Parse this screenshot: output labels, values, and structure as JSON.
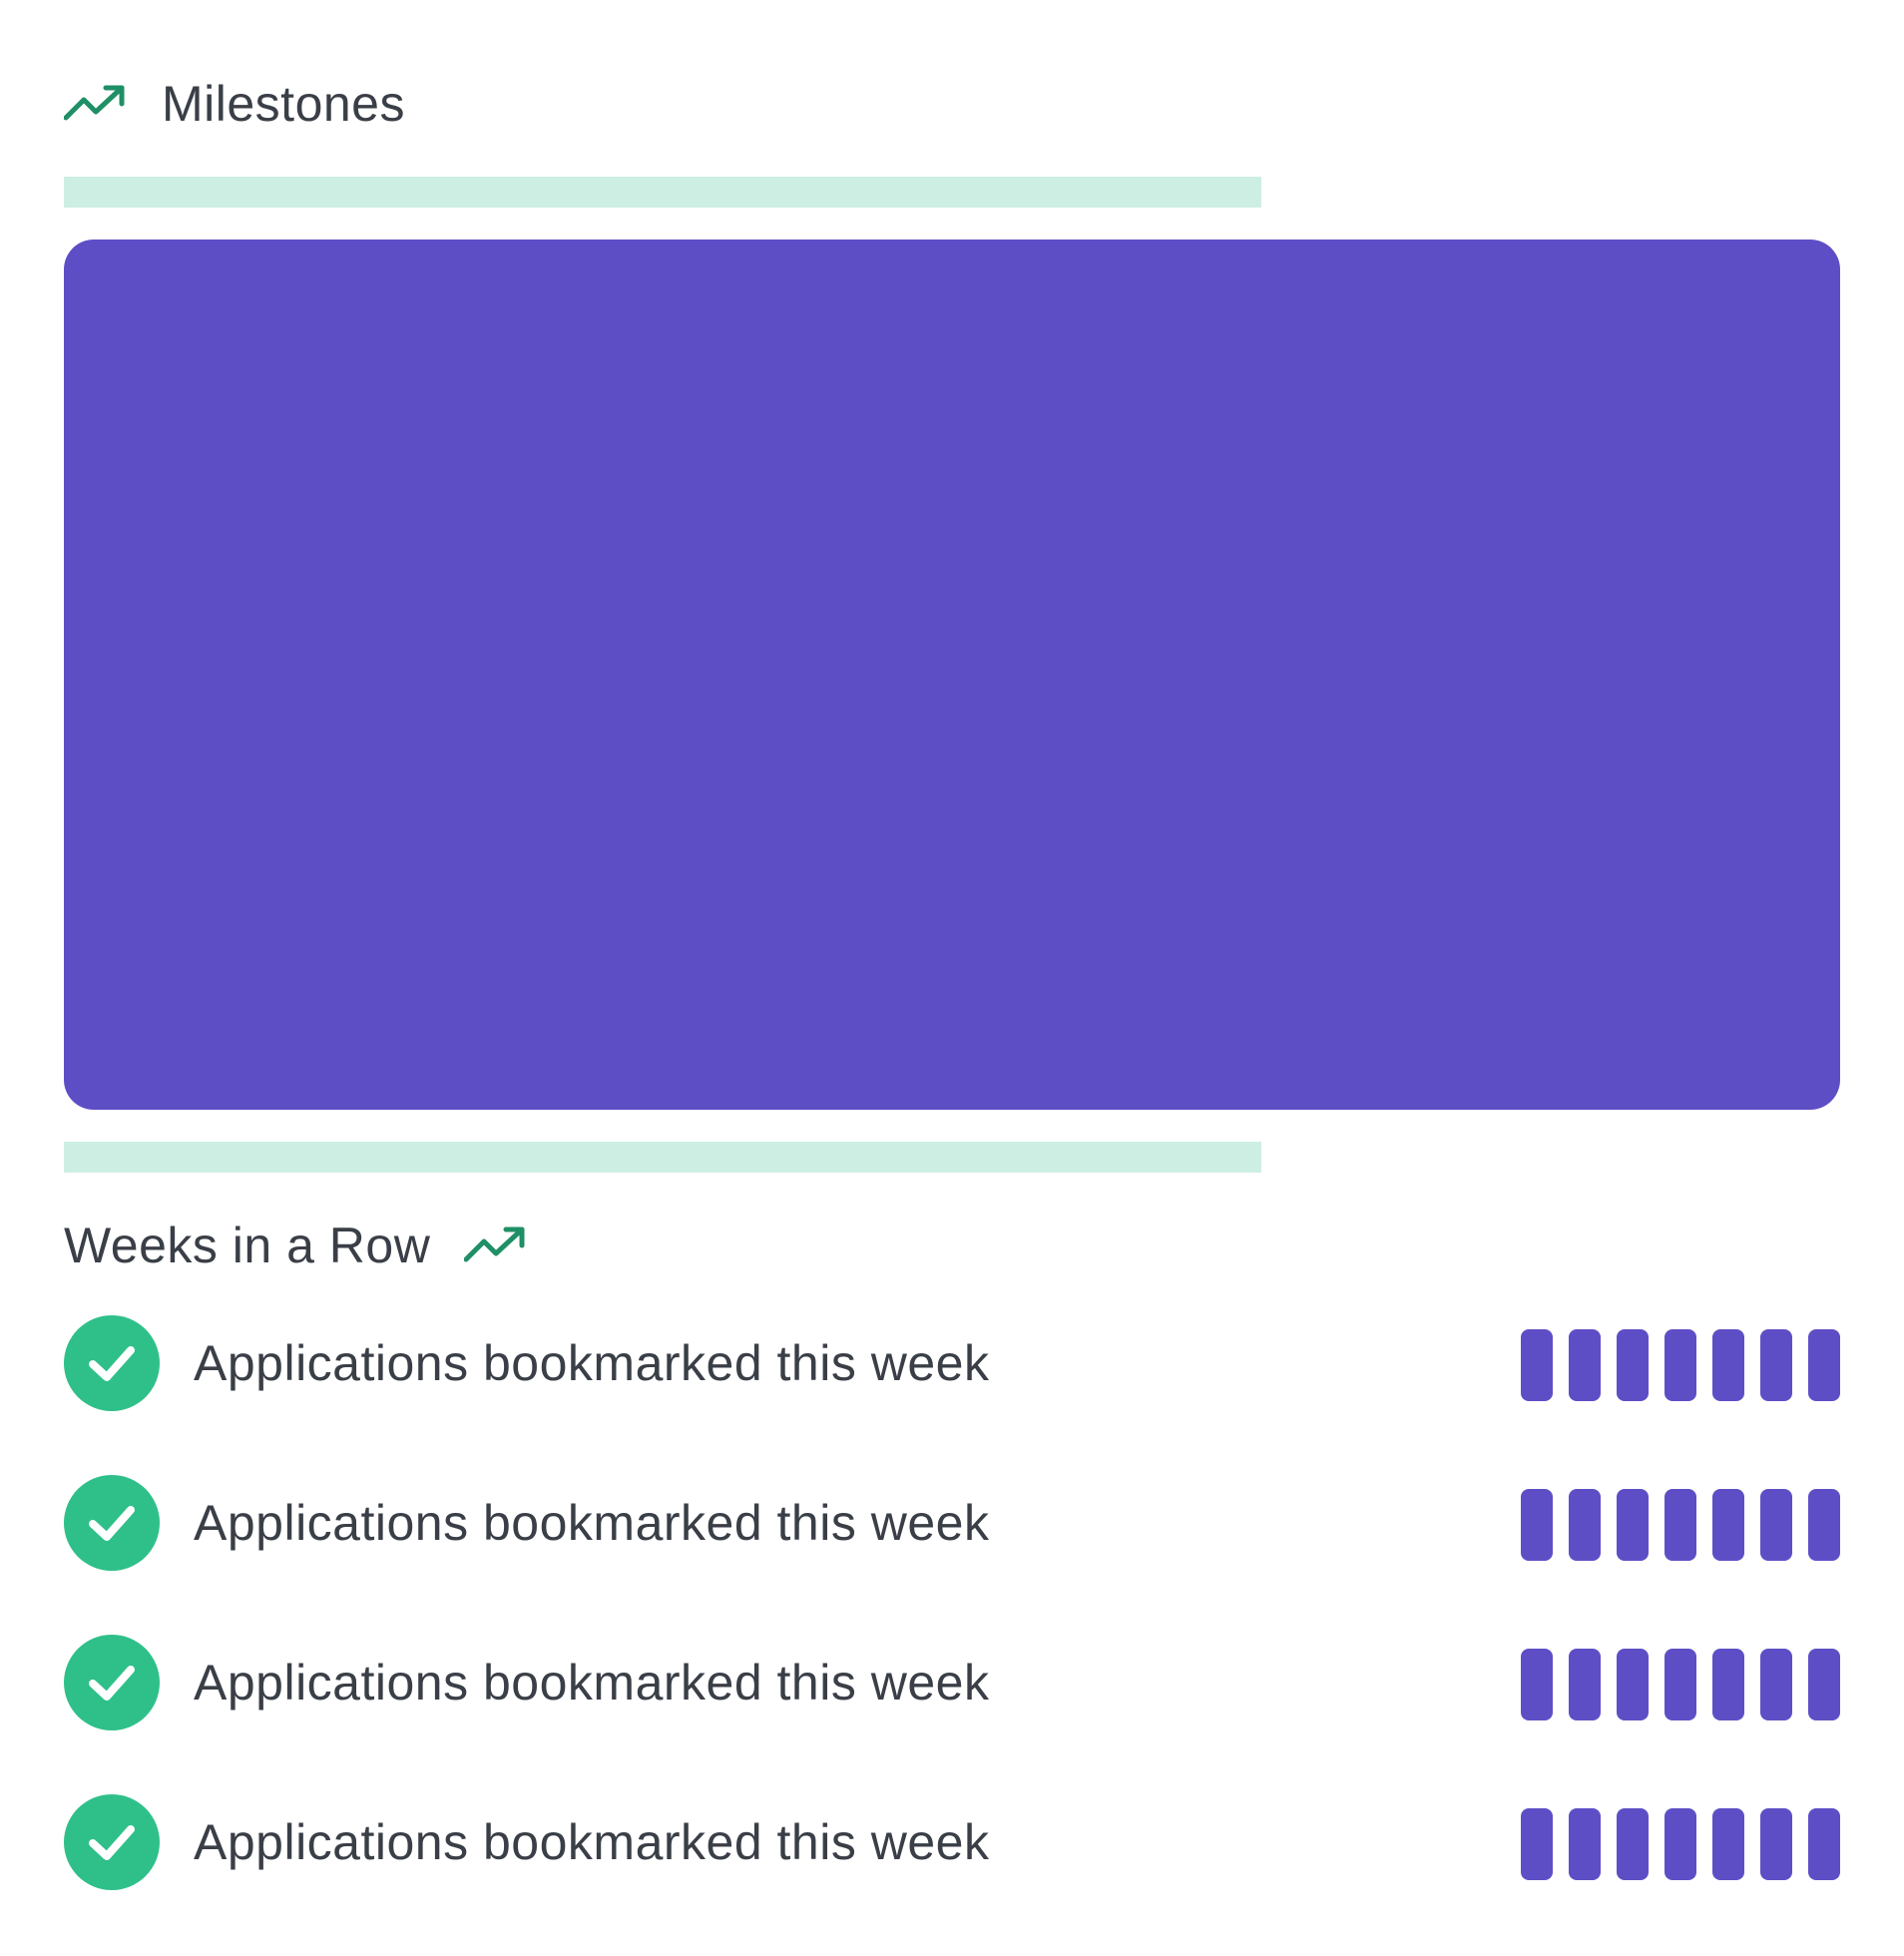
{
  "milestones": {
    "title": "Milestones",
    "icon": "trending-up-icon"
  },
  "weeks_in_a_row": {
    "title": "Weeks in a Row",
    "icon": "trending-up-icon",
    "items": [
      {
        "label": "Applications bookmarked this week",
        "completed": true,
        "weeks": 7
      },
      {
        "label": "Applications bookmarked this week",
        "completed": true,
        "weeks": 7
      },
      {
        "label": "Applications bookmarked this week",
        "completed": true,
        "weeks": 7
      },
      {
        "label": "Applications bookmarked this week",
        "completed": true,
        "weeks": 7
      }
    ]
  },
  "colors": {
    "accent_green": "#2fc08a",
    "trend_green": "#1f8f66",
    "skeleton_green": "#cdefe3",
    "purple": "#5e4ec6",
    "text": "#3a3f47"
  }
}
